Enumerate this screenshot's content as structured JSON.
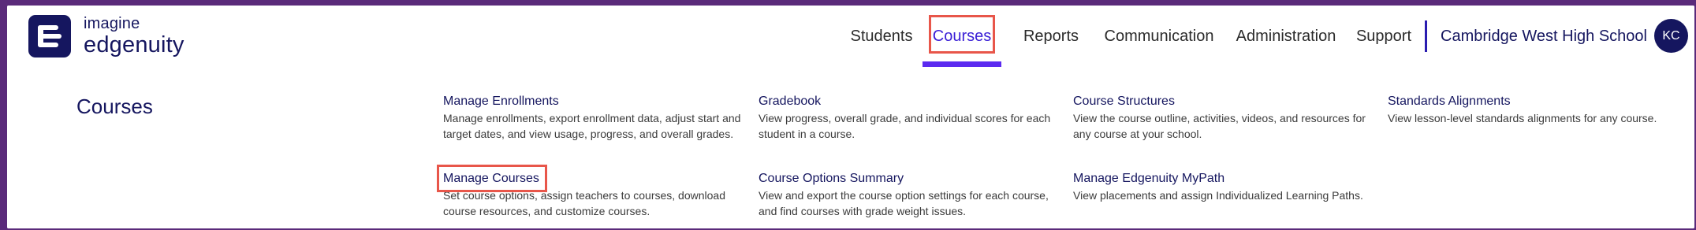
{
  "brand": {
    "line1": "imagine",
    "line2": "edgenuity",
    "color": "#15165f"
  },
  "nav": {
    "items": [
      {
        "label": "Students",
        "active": false
      },
      {
        "label": "Courses",
        "active": true
      },
      {
        "label": "Reports",
        "active": false
      },
      {
        "label": "Communication",
        "active": false
      },
      {
        "label": "Administration",
        "active": false
      },
      {
        "label": "Support",
        "active": false
      }
    ],
    "school": "Cambridge West High School",
    "avatar_initials": "KC",
    "active_color": "#3a1fd6",
    "highlight_color": "#e8564a"
  },
  "menu": {
    "title": "Courses",
    "items": [
      {
        "title": "Manage Enrollments",
        "desc": "Manage enrollments, export enrollment data, adjust start and target dates, and view usage, progress, and overall grades."
      },
      {
        "title": "Gradebook",
        "desc": "View progress, overall grade, and individual scores for each student in a course."
      },
      {
        "title": "Course Structures",
        "desc": "View the course outline, activities, videos, and resources for any course at your school."
      },
      {
        "title": "Standards Alignments",
        "desc": "View lesson-level standards alignments for any course."
      },
      {
        "title": "Manage Courses",
        "desc": "Set course options, assign teachers to courses, download course resources, and customize courses."
      },
      {
        "title": "Course Options Summary",
        "desc": "View and export the course option settings for each course, and find courses with grade weight issues."
      },
      {
        "title": "Manage Edgenuity MyPath",
        "desc": "View placements and assign Individualized Learning Paths."
      }
    ]
  }
}
